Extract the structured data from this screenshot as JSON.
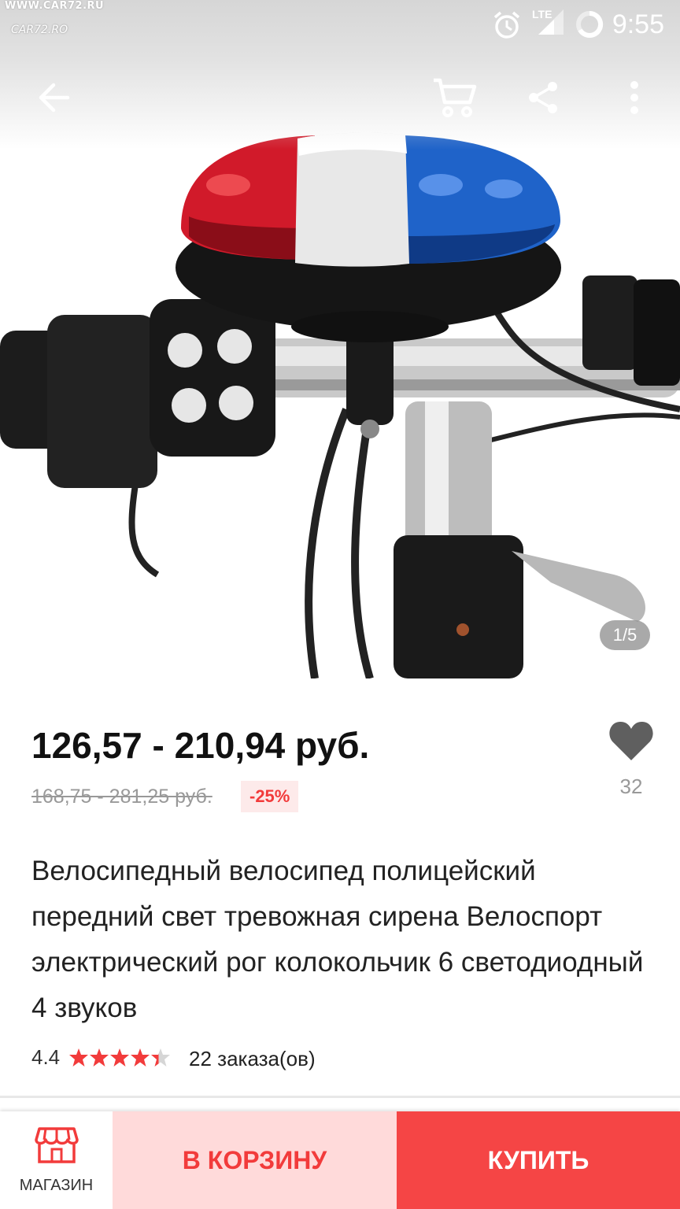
{
  "status_bar": {
    "watermark_top": "WWW.CAR72.RU",
    "watermark_logo": "CAR72.RO",
    "network": "LTE",
    "time": "9:55",
    "icons": [
      "alarm-icon",
      "signal-icon",
      "battery-icon"
    ]
  },
  "app_bar": {
    "icons": [
      "back-arrow-icon",
      "cart-icon",
      "share-icon",
      "more-vert-icon"
    ]
  },
  "gallery": {
    "counter": "1/5"
  },
  "product": {
    "price": "126,57 - 210,94 руб.",
    "old_price": "168,75 - 281,25 руб.",
    "discount": "-25%",
    "wishlist_count": "32",
    "title": "Велосипедный велосипед полицейский передний свет тревожная сирена Велоспорт электрический рог колокольчик 6 светодиодный 4 звуков",
    "rating": "4.4",
    "rating_value": 4.4,
    "rating_max": 5,
    "orders": "22 заказа(ов)"
  },
  "bottom_bar": {
    "shop_label": "МАГАЗИН",
    "cart_label": "В КОРЗИНУ",
    "buy_label": "КУПИТЬ"
  },
  "colors": {
    "accent": "#f23b3b",
    "cart_bg": "#ffdada",
    "buy_bg": "#f54545",
    "discount_bg": "#fdeaea"
  }
}
